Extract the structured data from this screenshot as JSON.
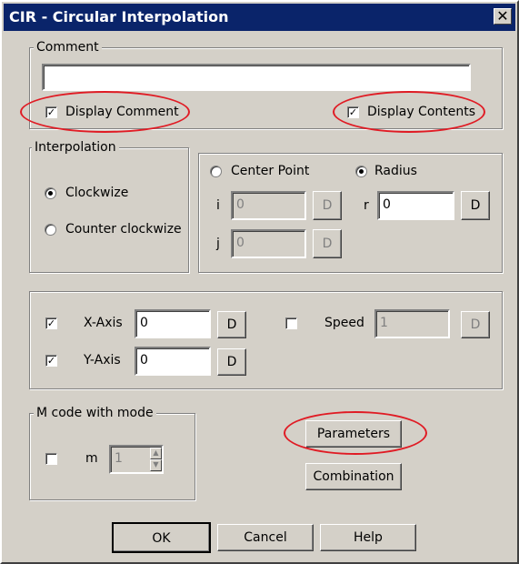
{
  "window": {
    "title": "CIR - Circular Interpolation",
    "close_glyph": "✕"
  },
  "comment": {
    "group_label": "Comment",
    "value": "",
    "display_comment": {
      "label": "Display Comment",
      "checked": true
    },
    "display_contents": {
      "label": "Display Contents",
      "checked": true
    }
  },
  "interpolation": {
    "group_label": "Interpolation",
    "clockwize": {
      "label": "Clockwize",
      "selected": true
    },
    "counter_clockwize": {
      "label": "Counter clockwize",
      "selected": false
    }
  },
  "center": {
    "center_point": {
      "label": "Center Point",
      "selected": false
    },
    "radius": {
      "label": "Radius",
      "selected": true
    },
    "i": {
      "label": "i",
      "value": "0",
      "button": "D",
      "enabled": false
    },
    "j": {
      "label": "j",
      "value": "0",
      "button": "D",
      "enabled": false
    },
    "r": {
      "label": "r",
      "value": "0",
      "button": "D",
      "enabled": true
    }
  },
  "axes": {
    "x_axis": {
      "label": "X-Axis",
      "checked": true,
      "value": "0",
      "button": "D"
    },
    "y_axis": {
      "label": "Y-Axis",
      "checked": true,
      "value": "0",
      "button": "D"
    },
    "speed": {
      "label": "Speed",
      "checked": false,
      "value": "1",
      "button": "D",
      "enabled": false
    }
  },
  "mcode": {
    "group_label": "M code with mode",
    "m": {
      "label": "m",
      "checked": false,
      "value": "1"
    }
  },
  "buttons": {
    "parameters": "Parameters",
    "combination": "Combination",
    "ok": "OK",
    "cancel": "Cancel",
    "help": "Help"
  },
  "colors": {
    "face": "#d4d0c8",
    "title_bar": "#0a246a",
    "highlight_ellipse": "#e01b24"
  }
}
